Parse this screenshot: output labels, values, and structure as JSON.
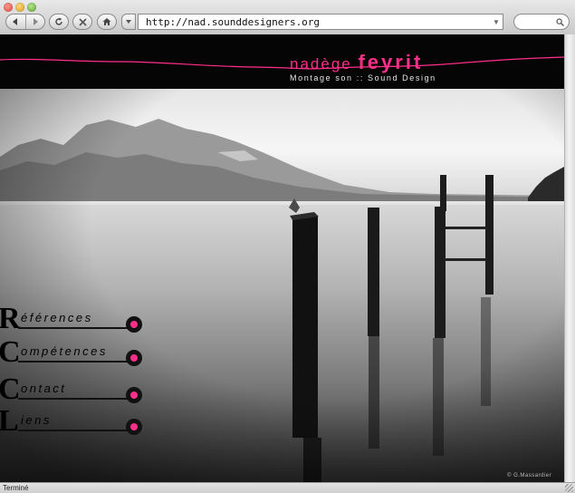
{
  "browser": {
    "url": "http://nad.sounddesigners.org",
    "status": "Terminé"
  },
  "site": {
    "name_first": "nadège",
    "name_last": "feyrit",
    "tagline": "Montage son :: Sound Design",
    "photo_credit": "© G.Massardier"
  },
  "nav": [
    {
      "initial": "R",
      "label": "éférences"
    },
    {
      "initial": "C",
      "label": "ompétences"
    },
    {
      "initial": "C",
      "label": "ontact"
    },
    {
      "initial": "L",
      "label": "iens"
    }
  ],
  "colors": {
    "accent": "#ff2e8a",
    "header_bg": "#050505"
  },
  "icons": {
    "back": "back-arrow-icon",
    "forward": "forward-arrow-icon",
    "reload": "reload-icon",
    "stop": "stop-icon",
    "home": "home-icon",
    "bookmark": "bookmark-icon",
    "search": "search-icon"
  }
}
